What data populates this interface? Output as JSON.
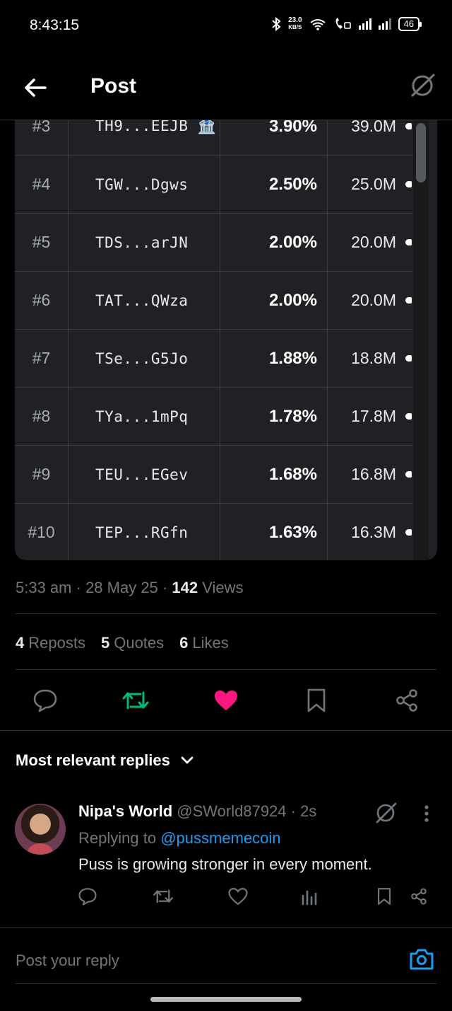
{
  "status_bar": {
    "time": "8:43:15",
    "speed_value": "23.0",
    "speed_unit": "KB/S",
    "battery": "46"
  },
  "header": {
    "title": "Post"
  },
  "table": {
    "rows": [
      {
        "rank": "#3",
        "address": "TH9...EEJB 🏦",
        "percent": "3.90%",
        "amount": "39.0M"
      },
      {
        "rank": "#4",
        "address": "TGW...Dgws",
        "percent": "2.50%",
        "amount": "25.0M"
      },
      {
        "rank": "#5",
        "address": "TDS...arJN",
        "percent": "2.00%",
        "amount": "20.0M"
      },
      {
        "rank": "#6",
        "address": "TAT...QWza",
        "percent": "2.00%",
        "amount": "20.0M"
      },
      {
        "rank": "#7",
        "address": "TSe...G5Jo",
        "percent": "1.88%",
        "amount": "18.8M"
      },
      {
        "rank": "#8",
        "address": "TYa...1mPq",
        "percent": "1.78%",
        "amount": "17.8M"
      },
      {
        "rank": "#9",
        "address": "TEU...EGev",
        "percent": "1.68%",
        "amount": "16.8M"
      },
      {
        "rank": "#10",
        "address": "TEP...RGfn",
        "percent": "1.63%",
        "amount": "16.3M"
      }
    ]
  },
  "meta": {
    "time": "5:33 am",
    "date": "28 May 25",
    "views_count": "142",
    "views_label": "Views"
  },
  "stats": {
    "reposts_count": "4",
    "reposts_label": "Reposts",
    "quotes_count": "5",
    "quotes_label": "Quotes",
    "likes_count": "6",
    "likes_label": "Likes"
  },
  "colors": {
    "repost_active": "#00ba7c",
    "like_active": "#f91880",
    "link": "#1d9bf0"
  },
  "replies": {
    "sort_label": "Most relevant replies",
    "items": [
      {
        "name": "Nipa's World",
        "handle": "@SWorld87924 · 2s",
        "replying_prefix": "Replying to",
        "replying_to": "@pussmemecoin",
        "text": "Puss is growing stronger in every moment."
      }
    ]
  },
  "compose": {
    "placeholder": "Post your reply"
  }
}
